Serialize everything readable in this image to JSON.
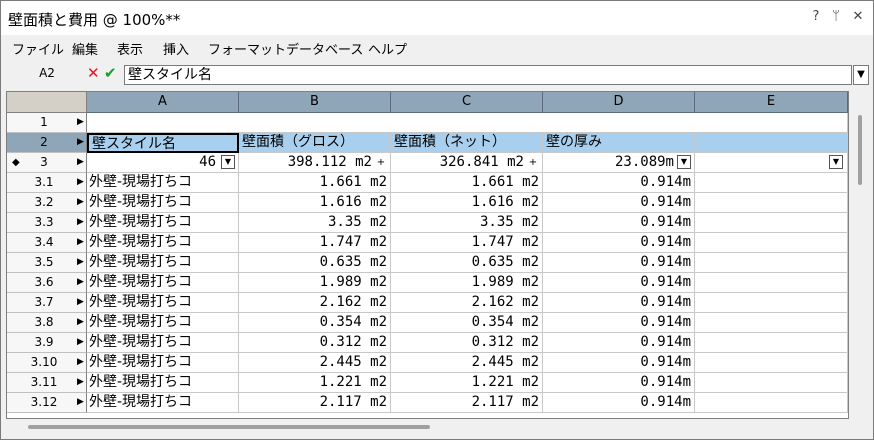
{
  "window": {
    "title": "壁面積と費用 @ 100%**",
    "help_label": "?",
    "pin_label": "ᛘ",
    "close_label": "✕"
  },
  "menu": [
    "ファイル",
    "編集",
    "表示",
    "挿入",
    "フォーマット",
    "データベース",
    "ヘルプ"
  ],
  "formula_bar": {
    "cell_ref": "A2",
    "cancel_label": "✕",
    "accept_label": "✔",
    "value": "壁スタイル名",
    "dropdown_label": "▼"
  },
  "columns": [
    "A",
    "B",
    "C",
    "D",
    "E"
  ],
  "header_row": {
    "row_label": "2",
    "cells": [
      "壁スタイル名",
      "壁面積（グロス）",
      "壁面積（ネット）",
      "壁の厚み",
      ""
    ]
  },
  "empty_row": {
    "row_label": "1"
  },
  "summary_row": {
    "row_label": "3",
    "cells": [
      "46",
      "398.112 m2",
      "326.841 m2",
      "23.089m",
      ""
    ]
  },
  "rows": [
    {
      "label": "3.1",
      "style": "外壁-現場打ちコ",
      "gross": "1.661 m2",
      "net": "1.661 m2",
      "thickness": "0.914m"
    },
    {
      "label": "3.2",
      "style": "外壁-現場打ちコ",
      "gross": "1.616 m2",
      "net": "1.616 m2",
      "thickness": "0.914m"
    },
    {
      "label": "3.3",
      "style": "外壁-現場打ちコ",
      "gross": "3.35 m2",
      "net": "3.35 m2",
      "thickness": "0.914m"
    },
    {
      "label": "3.4",
      "style": "外壁-現場打ちコ",
      "gross": "1.747 m2",
      "net": "1.747 m2",
      "thickness": "0.914m"
    },
    {
      "label": "3.5",
      "style": "外壁-現場打ちコ",
      "gross": "0.635 m2",
      "net": "0.635 m2",
      "thickness": "0.914m"
    },
    {
      "label": "3.6",
      "style": "外壁-現場打ちコ",
      "gross": "1.989 m2",
      "net": "1.989 m2",
      "thickness": "0.914m"
    },
    {
      "label": "3.7",
      "style": "外壁-現場打ちコ",
      "gross": "2.162 m2",
      "net": "2.162 m2",
      "thickness": "0.914m"
    },
    {
      "label": "3.8",
      "style": "外壁-現場打ちコ",
      "gross": "0.354 m2",
      "net": "0.354 m2",
      "thickness": "0.914m"
    },
    {
      "label": "3.9",
      "style": "外壁-現場打ちコ",
      "gross": "0.312 m2",
      "net": "0.312 m2",
      "thickness": "0.914m"
    },
    {
      "label": "3.10",
      "style": "外壁-現場打ちコ",
      "gross": "2.445 m2",
      "net": "2.445 m2",
      "thickness": "0.914m"
    },
    {
      "label": "3.11",
      "style": "外壁-現場打ちコ",
      "gross": "1.221 m2",
      "net": "1.221 m2",
      "thickness": "0.914m"
    },
    {
      "label": "3.12",
      "style": "外壁-現場打ちコ",
      "gross": "2.117 m2",
      "net": "2.117 m2",
      "thickness": "0.914m"
    }
  ]
}
